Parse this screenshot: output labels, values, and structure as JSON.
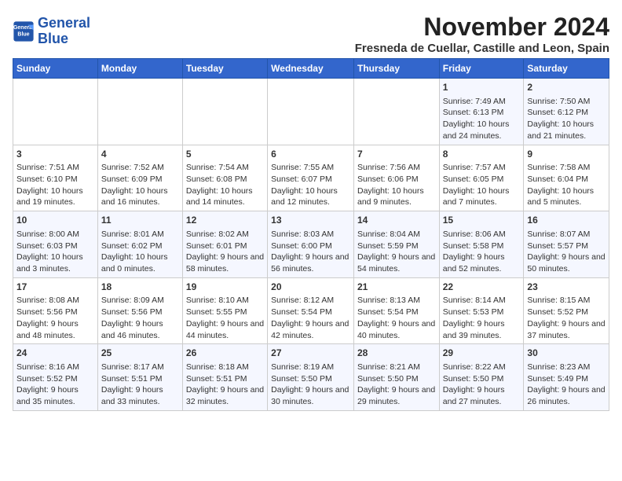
{
  "header": {
    "logo_line1": "General",
    "logo_line2": "Blue",
    "month": "November 2024",
    "location": "Fresneda de Cuellar, Castille and Leon, Spain"
  },
  "days_of_week": [
    "Sunday",
    "Monday",
    "Tuesday",
    "Wednesday",
    "Thursday",
    "Friday",
    "Saturday"
  ],
  "weeks": [
    [
      {
        "day": "",
        "text": ""
      },
      {
        "day": "",
        "text": ""
      },
      {
        "day": "",
        "text": ""
      },
      {
        "day": "",
        "text": ""
      },
      {
        "day": "",
        "text": ""
      },
      {
        "day": "1",
        "text": "Sunrise: 7:49 AM\nSunset: 6:13 PM\nDaylight: 10 hours and 24 minutes."
      },
      {
        "day": "2",
        "text": "Sunrise: 7:50 AM\nSunset: 6:12 PM\nDaylight: 10 hours and 21 minutes."
      }
    ],
    [
      {
        "day": "3",
        "text": "Sunrise: 7:51 AM\nSunset: 6:10 PM\nDaylight: 10 hours and 19 minutes."
      },
      {
        "day": "4",
        "text": "Sunrise: 7:52 AM\nSunset: 6:09 PM\nDaylight: 10 hours and 16 minutes."
      },
      {
        "day": "5",
        "text": "Sunrise: 7:54 AM\nSunset: 6:08 PM\nDaylight: 10 hours and 14 minutes."
      },
      {
        "day": "6",
        "text": "Sunrise: 7:55 AM\nSunset: 6:07 PM\nDaylight: 10 hours and 12 minutes."
      },
      {
        "day": "7",
        "text": "Sunrise: 7:56 AM\nSunset: 6:06 PM\nDaylight: 10 hours and 9 minutes."
      },
      {
        "day": "8",
        "text": "Sunrise: 7:57 AM\nSunset: 6:05 PM\nDaylight: 10 hours and 7 minutes."
      },
      {
        "day": "9",
        "text": "Sunrise: 7:58 AM\nSunset: 6:04 PM\nDaylight: 10 hours and 5 minutes."
      }
    ],
    [
      {
        "day": "10",
        "text": "Sunrise: 8:00 AM\nSunset: 6:03 PM\nDaylight: 10 hours and 3 minutes."
      },
      {
        "day": "11",
        "text": "Sunrise: 8:01 AM\nSunset: 6:02 PM\nDaylight: 10 hours and 0 minutes."
      },
      {
        "day": "12",
        "text": "Sunrise: 8:02 AM\nSunset: 6:01 PM\nDaylight: 9 hours and 58 minutes."
      },
      {
        "day": "13",
        "text": "Sunrise: 8:03 AM\nSunset: 6:00 PM\nDaylight: 9 hours and 56 minutes."
      },
      {
        "day": "14",
        "text": "Sunrise: 8:04 AM\nSunset: 5:59 PM\nDaylight: 9 hours and 54 minutes."
      },
      {
        "day": "15",
        "text": "Sunrise: 8:06 AM\nSunset: 5:58 PM\nDaylight: 9 hours and 52 minutes."
      },
      {
        "day": "16",
        "text": "Sunrise: 8:07 AM\nSunset: 5:57 PM\nDaylight: 9 hours and 50 minutes."
      }
    ],
    [
      {
        "day": "17",
        "text": "Sunrise: 8:08 AM\nSunset: 5:56 PM\nDaylight: 9 hours and 48 minutes."
      },
      {
        "day": "18",
        "text": "Sunrise: 8:09 AM\nSunset: 5:56 PM\nDaylight: 9 hours and 46 minutes."
      },
      {
        "day": "19",
        "text": "Sunrise: 8:10 AM\nSunset: 5:55 PM\nDaylight: 9 hours and 44 minutes."
      },
      {
        "day": "20",
        "text": "Sunrise: 8:12 AM\nSunset: 5:54 PM\nDaylight: 9 hours and 42 minutes."
      },
      {
        "day": "21",
        "text": "Sunrise: 8:13 AM\nSunset: 5:54 PM\nDaylight: 9 hours and 40 minutes."
      },
      {
        "day": "22",
        "text": "Sunrise: 8:14 AM\nSunset: 5:53 PM\nDaylight: 9 hours and 39 minutes."
      },
      {
        "day": "23",
        "text": "Sunrise: 8:15 AM\nSunset: 5:52 PM\nDaylight: 9 hours and 37 minutes."
      }
    ],
    [
      {
        "day": "24",
        "text": "Sunrise: 8:16 AM\nSunset: 5:52 PM\nDaylight: 9 hours and 35 minutes."
      },
      {
        "day": "25",
        "text": "Sunrise: 8:17 AM\nSunset: 5:51 PM\nDaylight: 9 hours and 33 minutes."
      },
      {
        "day": "26",
        "text": "Sunrise: 8:18 AM\nSunset: 5:51 PM\nDaylight: 9 hours and 32 minutes."
      },
      {
        "day": "27",
        "text": "Sunrise: 8:19 AM\nSunset: 5:50 PM\nDaylight: 9 hours and 30 minutes."
      },
      {
        "day": "28",
        "text": "Sunrise: 8:21 AM\nSunset: 5:50 PM\nDaylight: 9 hours and 29 minutes."
      },
      {
        "day": "29",
        "text": "Sunrise: 8:22 AM\nSunset: 5:50 PM\nDaylight: 9 hours and 27 minutes."
      },
      {
        "day": "30",
        "text": "Sunrise: 8:23 AM\nSunset: 5:49 PM\nDaylight: 9 hours and 26 minutes."
      }
    ]
  ]
}
